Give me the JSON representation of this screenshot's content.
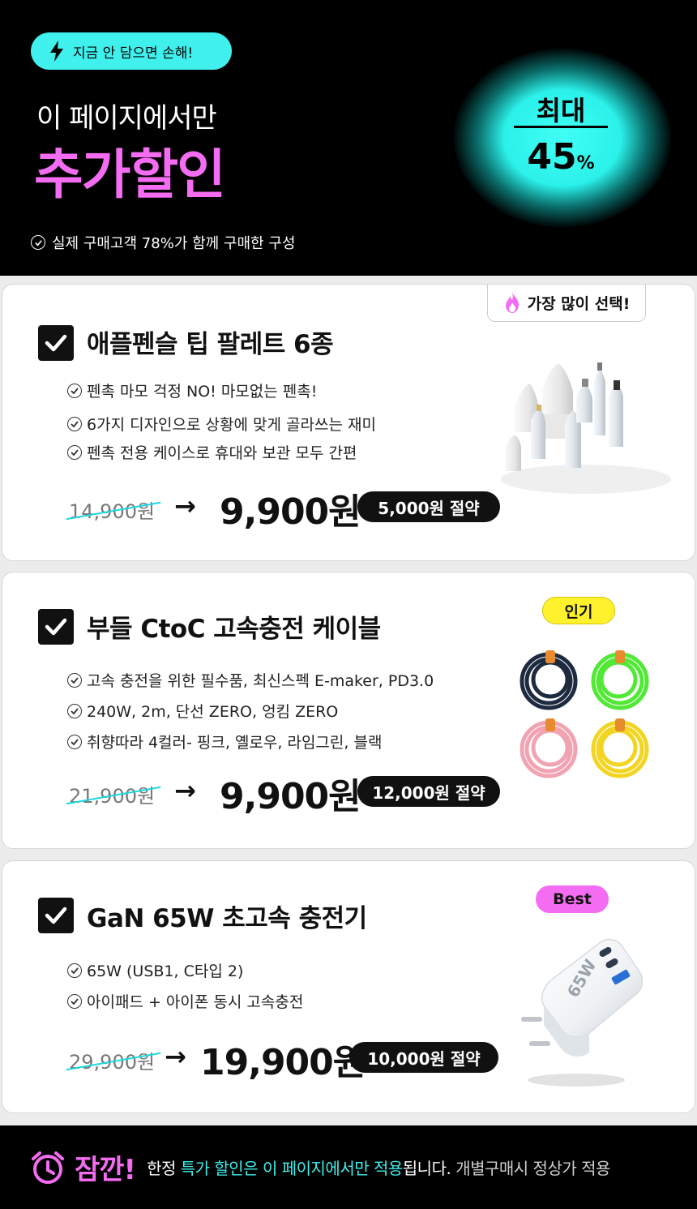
{
  "hero": {
    "pill_text": "지금 안 담으면 손해!",
    "subtitle": "이 페이지에서만",
    "title": "추가할인",
    "note": "실제 구매고객 78%가 함께 구매한 구성",
    "badge_top": "최대",
    "badge_value": "45",
    "badge_unit": "%"
  },
  "products": [
    {
      "tag": "가장 많이 선택!",
      "title": "애플펜슬 팁 팔레트 6종",
      "features": [
        "펜촉 마모 걱정 NO! 마모없는 펜촉!",
        "6가지 디자인으로 상황에 맞게 골라쓰는 재미",
        "펜촉 전용 케이스로 휴대와 보관 모두 간편"
      ],
      "old_price": "14,900원",
      "arrow": "→",
      "price": "9,900원",
      "saving": "5,000원 절약"
    },
    {
      "tag": "인기",
      "title": "부들 CtoC 고속충전 케이블",
      "features": [
        "고속 충전을 위한 필수품, 최신스펙 E-maker, PD3.0",
        "240W, 2m, 단선 ZERO, 엉킴 ZERO",
        "취향따라 4컬러- 핑크, 옐로우, 라임그린, 블랙"
      ],
      "old_price": "21,900원",
      "arrow": "→",
      "price": "9,900원",
      "saving": "12,000원 절약"
    },
    {
      "tag": "Best",
      "title": "GaN 65W 초고속 충전기",
      "features": [
        "65W (USB1, C타입 2)",
        "아이패드 + 아이폰 동시 고속충전"
      ],
      "old_price": "29,900원",
      "arrow": "→",
      "price": "19,900원",
      "saving": "10,000원 절약",
      "charger_label": "65W"
    }
  ],
  "footer": {
    "wait": "잠깐!",
    "text_1": "한정",
    "text_highlight_1": "특가 할인은 이 페이지에서만 적용",
    "text_2": "됩니다.",
    "text_dim": "개별구매시 정상가 적용"
  },
  "colors": {
    "accent_cyan": "#3ff0ec",
    "accent_pink": "#f46cf1",
    "tag_yellow": "#fff22c"
  },
  "icons": [
    "lightning-icon",
    "check-circle-icon",
    "checkbox-icon",
    "fire-icon",
    "alarm-clock-icon"
  ]
}
